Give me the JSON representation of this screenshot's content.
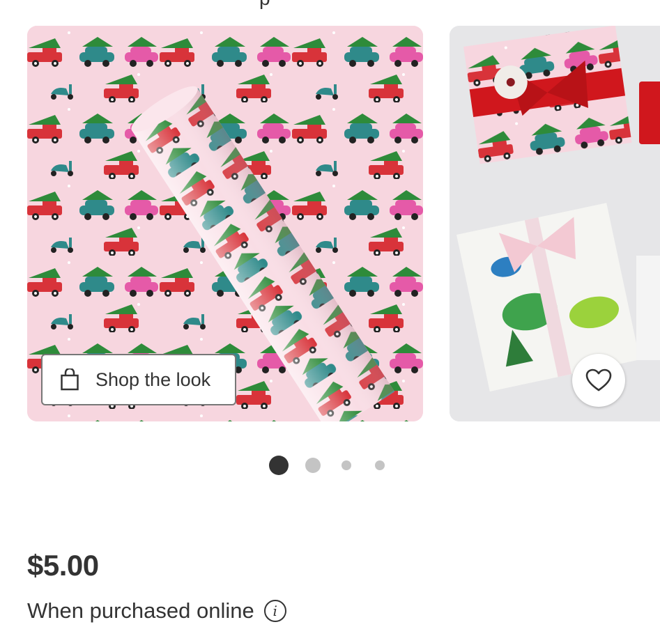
{
  "header": {
    "cutoff_text": "p"
  },
  "gallery": {
    "main_image": "pink wrapping paper with cars carrying christmas trees",
    "next_image": "wrapped gift boxes",
    "shop_the_look_label": "Shop the look",
    "shop_icon": "shopping-bag-icon",
    "favorite_icon": "heart-icon",
    "pagination": {
      "total": 4,
      "active": 1
    }
  },
  "product": {
    "price": "$5.00",
    "purchase_note": "When purchased online",
    "info_icon": "info-icon",
    "info_glyph": "i"
  },
  "colors": {
    "wrap_pink": "#f7d6df",
    "car_red": "#d8333a",
    "car_teal": "#2f8a8a",
    "tree_green": "#2e8b3a",
    "ribbon_red": "#d0171d"
  }
}
